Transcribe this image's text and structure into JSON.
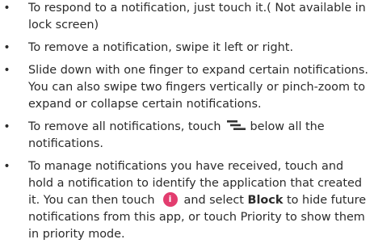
{
  "colors": {
    "text": "#2b2b2b",
    "icon_dark": "#333333",
    "info_icon_bg": "#e23d6f"
  },
  "bullets": {
    "b1": "To respond to a notification, just touch it.( Not available in lock screen)",
    "b2": "To remove a notification, swipe it left or right.",
    "b3": "Slide down with one finger to expand certain notifications. You can also swipe two fingers vertically or pinch-zoom to expand or collapse certain notifications.",
    "b4_before": "To remove all notifications, touch",
    "b4_icon": "clear-all-icon",
    "b4_after": "below all the notifications.",
    "b5_before": "To manage notifications you have received, touch and hold a notification to identify the application that created it. You can then touch",
    "b5_icon": "info-icon",
    "b5_icon_glyph": "i",
    "b5_mid": "and select",
    "b5_bold": "Block",
    "b5_after": "to hide future notifications from this app, or touch Priority to show them in priority mode."
  },
  "bullet_marker": "•"
}
